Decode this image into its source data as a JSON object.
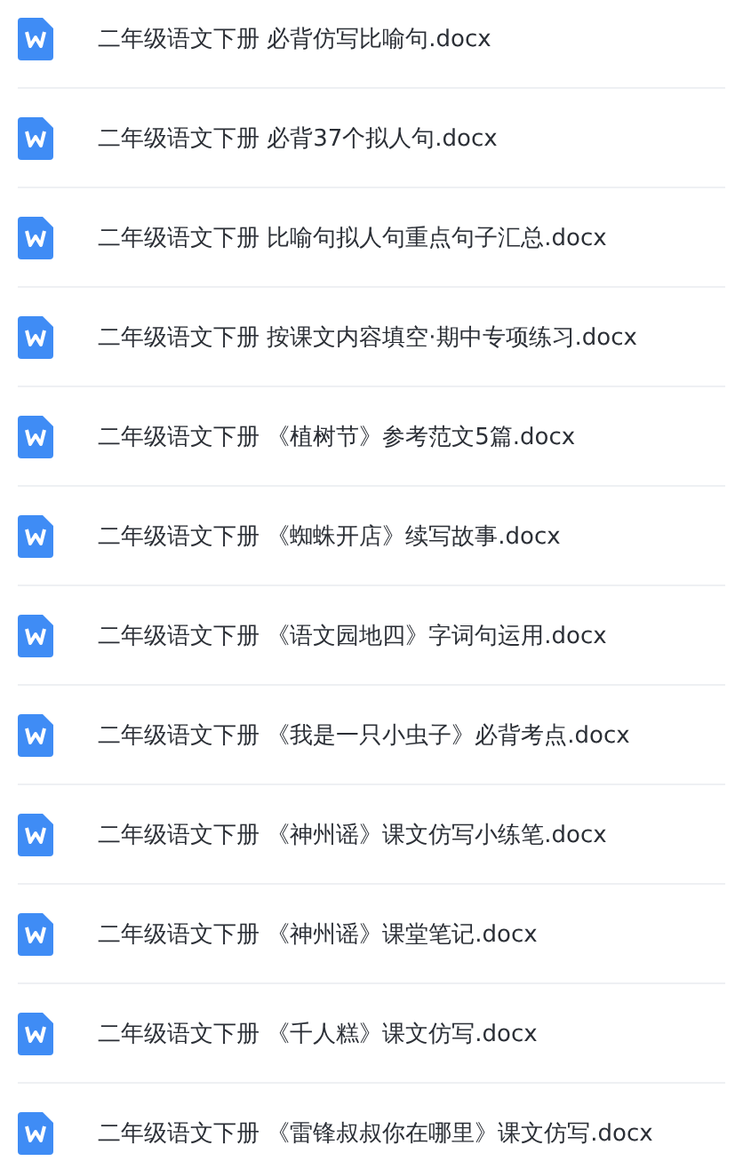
{
  "files": [
    {
      "name": "二年级语文下册 必背仿写比喻句.docx"
    },
    {
      "name": "二年级语文下册 必背37个拟人句.docx"
    },
    {
      "name": "二年级语文下册 比喻句拟人句重点句子汇总.docx"
    },
    {
      "name": "二年级语文下册 按课文内容填空·期中专项练习.docx"
    },
    {
      "name": "二年级语文下册 《植树节》参考范文5篇.docx"
    },
    {
      "name": "二年级语文下册 《蜘蛛开店》续写故事.docx"
    },
    {
      "name": "二年级语文下册 《语文园地四》字词句运用.docx"
    },
    {
      "name": "二年级语文下册 《我是一只小虫子》必背考点.docx"
    },
    {
      "name": "二年级语文下册 《神州谣》课文仿写小练笔.docx"
    },
    {
      "name": "二年级语文下册 《神州谣》课堂笔记.docx"
    },
    {
      "name": "二年级语文下册 《千人糕》课文仿写.docx"
    },
    {
      "name": "二年级语文下册 《雷锋叔叔你在哪里》课文仿写.docx"
    }
  ]
}
